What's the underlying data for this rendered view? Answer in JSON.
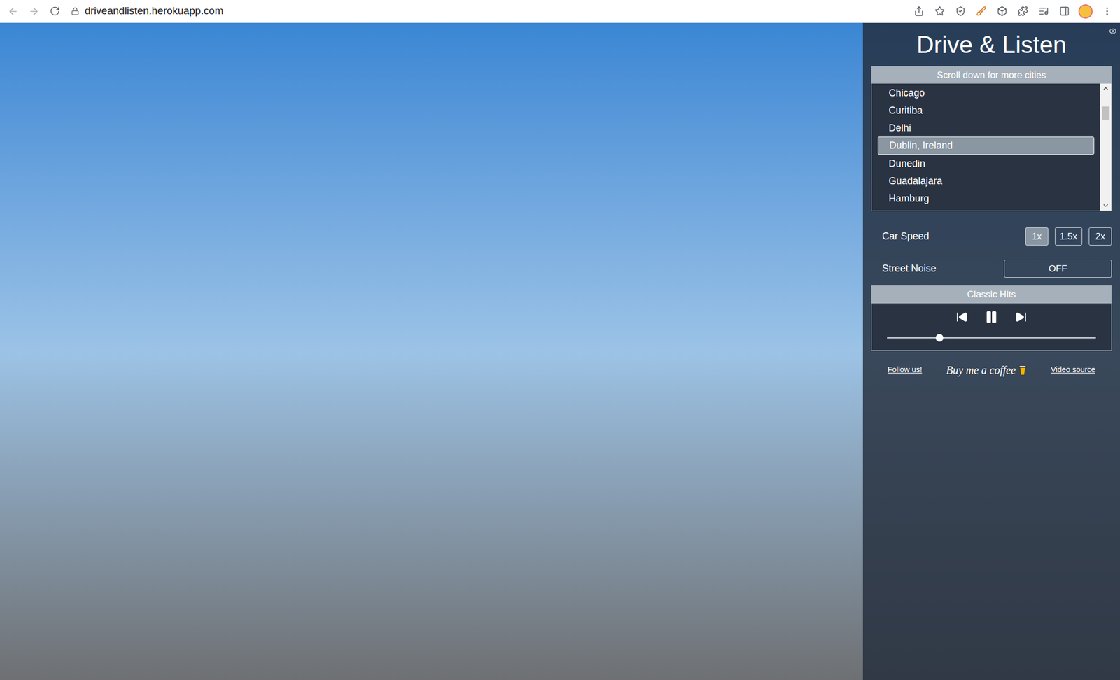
{
  "browser": {
    "url": "driveandlisten.herokuapp.com"
  },
  "panel": {
    "title": "Drive & Listen",
    "city_list": {
      "header": "Scroll down for more cities",
      "items": [
        {
          "label": "Chicago",
          "selected": false
        },
        {
          "label": "Curitiba",
          "selected": false
        },
        {
          "label": "Delhi",
          "selected": false
        },
        {
          "label": "Dublin, Ireland",
          "selected": true
        },
        {
          "label": "Dunedin",
          "selected": false
        },
        {
          "label": "Guadalajara",
          "selected": false
        },
        {
          "label": "Hamburg",
          "selected": false
        }
      ]
    },
    "car_speed": {
      "label": "Car Speed",
      "options": [
        {
          "label": "1x",
          "selected": true
        },
        {
          "label": "1.5x",
          "selected": false
        },
        {
          "label": "2x",
          "selected": false
        }
      ]
    },
    "street_noise": {
      "label": "Street Noise",
      "value": "OFF"
    },
    "player": {
      "station": "Classic Hits",
      "playing": true,
      "level": 0.25
    },
    "links": {
      "follow": "Follow us!",
      "coffee": "Buy me a coffee",
      "source": "Video source"
    }
  }
}
